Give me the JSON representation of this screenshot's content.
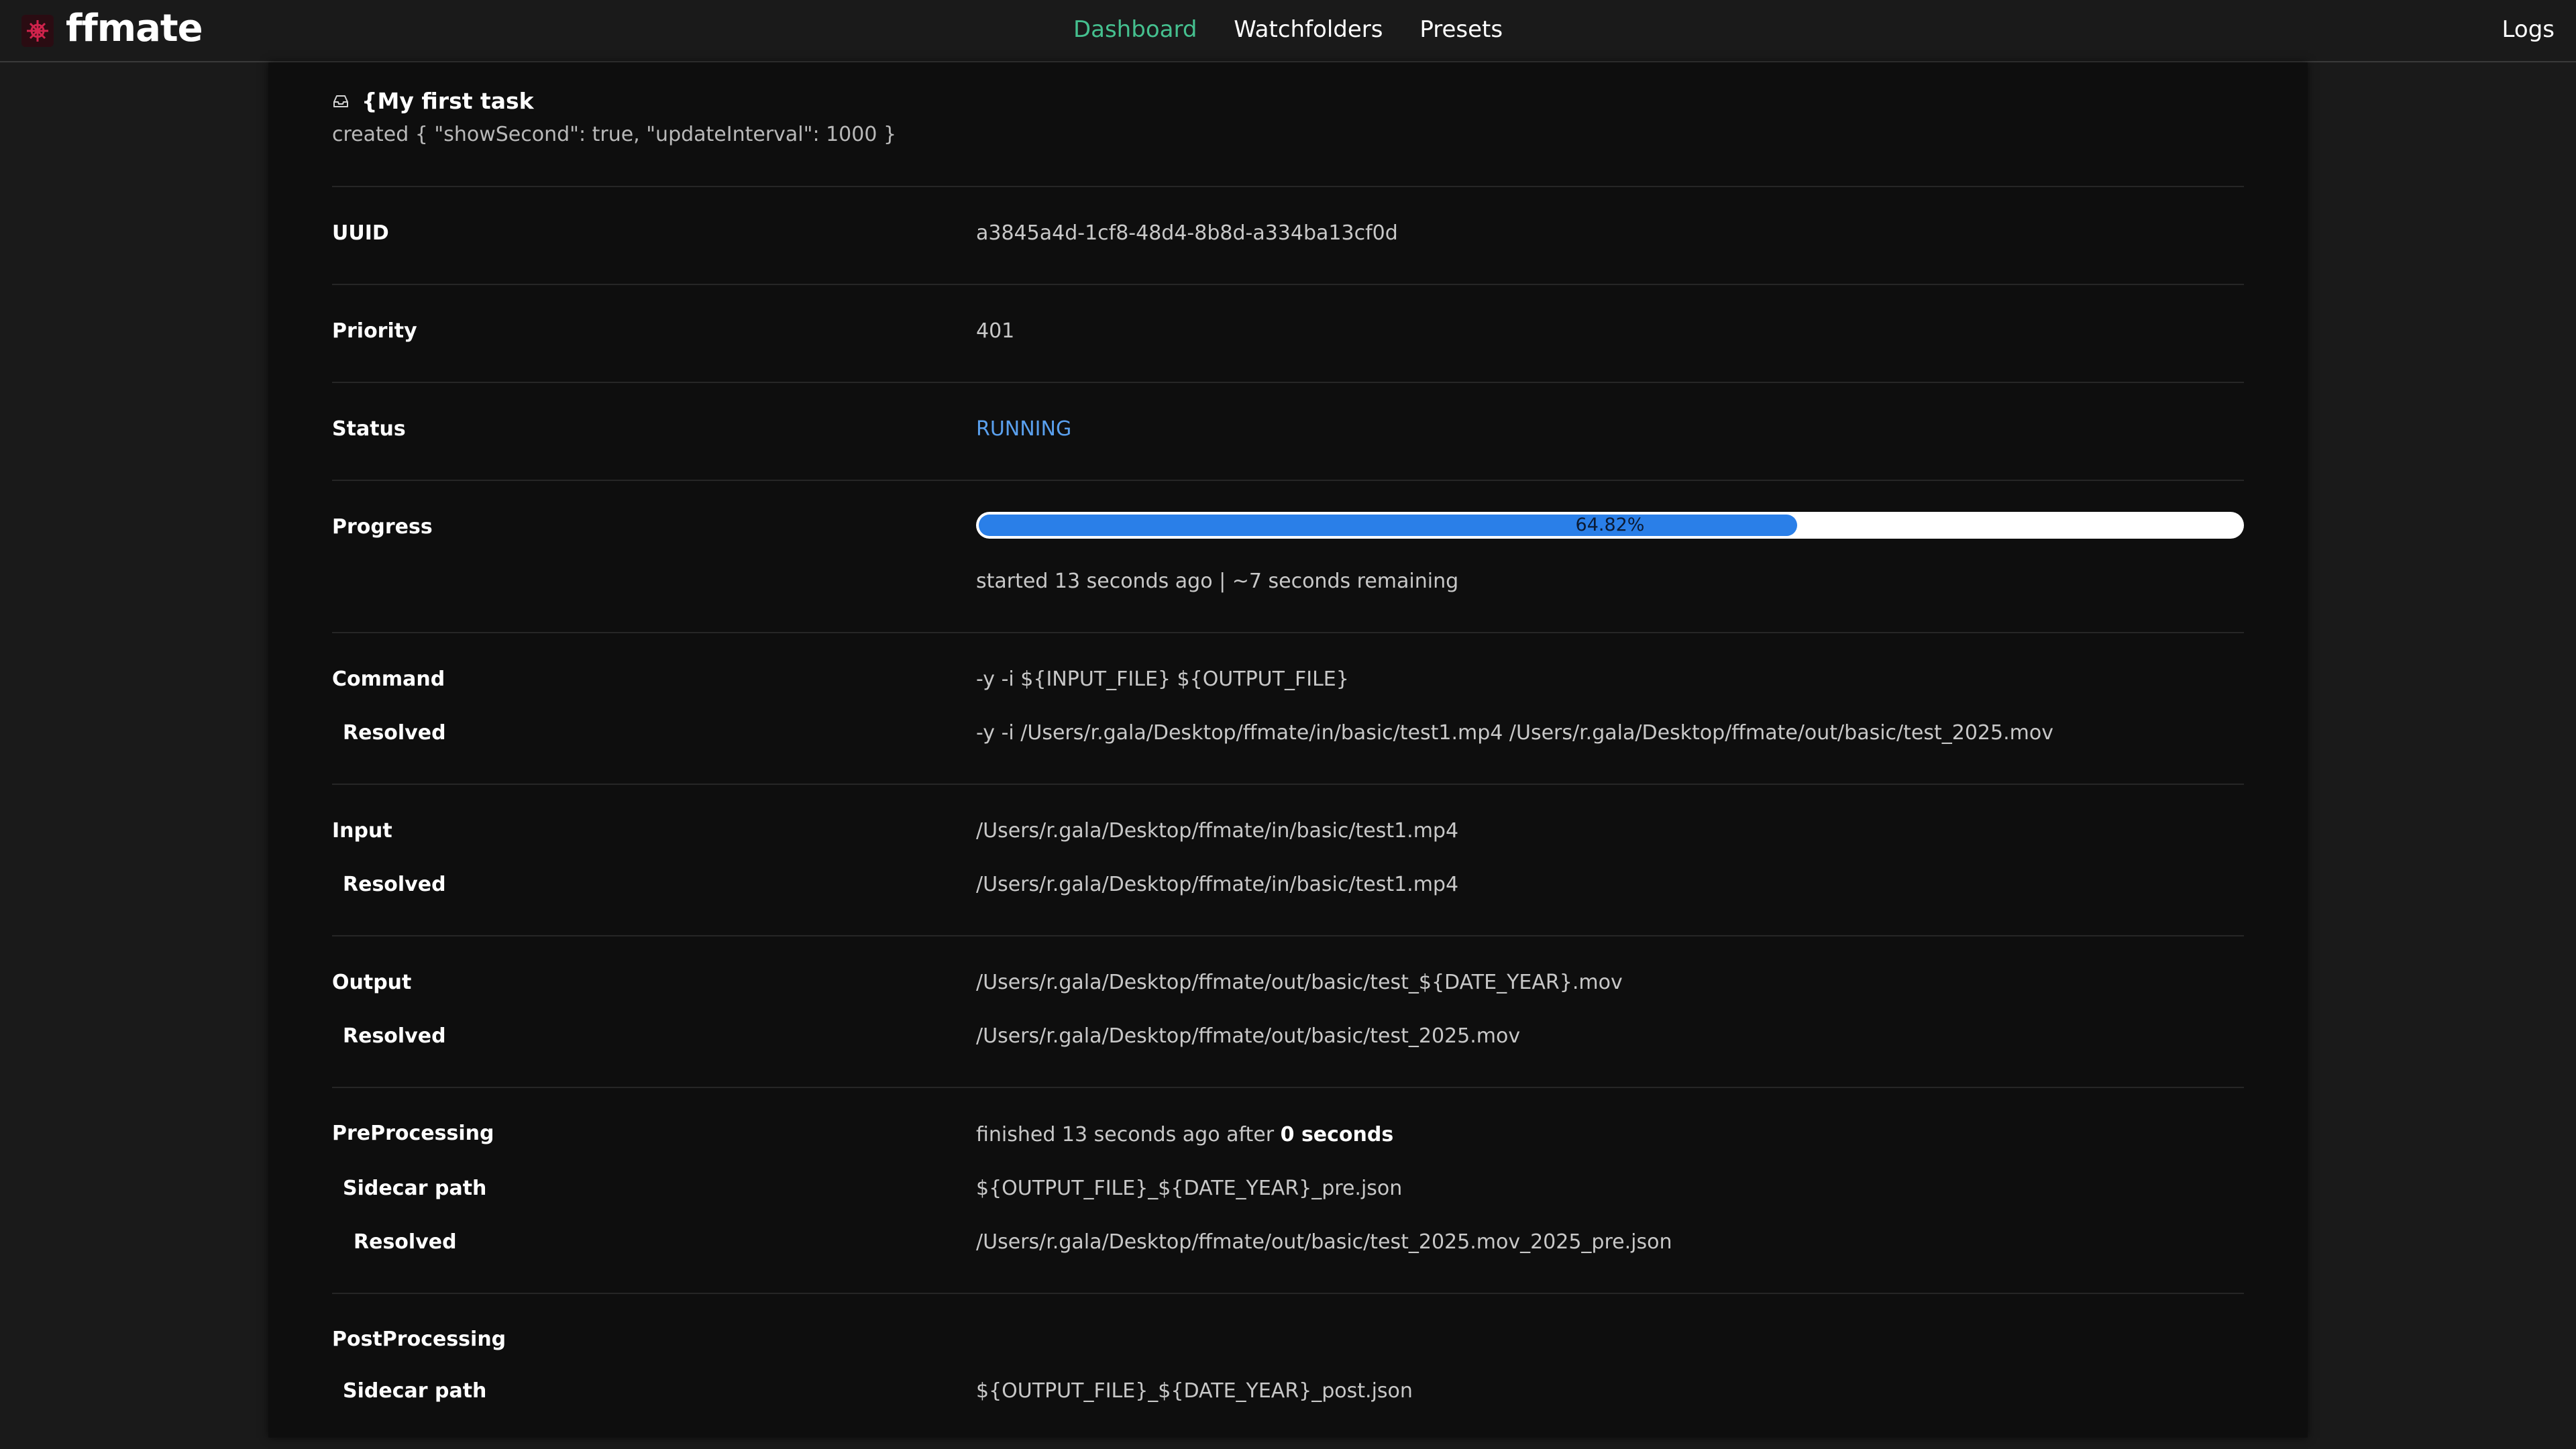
{
  "nav": {
    "brand": "ffmate",
    "links": [
      "Dashboard",
      "Watchfolders",
      "Presets"
    ],
    "active": "Dashboard",
    "logs": "Logs"
  },
  "task": {
    "title": "{My first task",
    "created": "created { \"showSecond\": true, \"updateInterval\": 1000 }",
    "uuid_label": "UUID",
    "uuid": "a3845a4d-1cf8-48d4-8b8d-a334ba13cf0d",
    "priority_label": "Priority",
    "priority": "401",
    "status_label": "Status",
    "status": "RUNNING",
    "progress_label": "Progress",
    "progress_percent": 64.82,
    "progress_text": "64.82%",
    "progress_meta": "started 13 seconds ago | ~7 seconds remaining",
    "command_label": "Command",
    "command": "-y -i ${INPUT_FILE} ${OUTPUT_FILE}",
    "resolved_label": "Resolved",
    "command_resolved": "-y -i /Users/r.gala/Desktop/ffmate/in/basic/test1.mp4 /Users/r.gala/Desktop/ffmate/out/basic/test_2025.mov",
    "input_label": "Input",
    "input": "/Users/r.gala/Desktop/ffmate/in/basic/test1.mp4",
    "input_resolved": "/Users/r.gala/Desktop/ffmate/in/basic/test1.mp4",
    "output_label": "Output",
    "output": "/Users/r.gala/Desktop/ffmate/out/basic/test_${DATE_YEAR}.mov",
    "output_resolved": "/Users/r.gala/Desktop/ffmate/out/basic/test_2025.mov",
    "pre_label": "PreProcessing",
    "pre_status_prefix": "finished 13 seconds ago after ",
    "pre_status_duration": "0 seconds",
    "sidecar_label": "Sidecar path",
    "pre_sidecar": "${OUTPUT_FILE}_${DATE_YEAR}_pre.json",
    "pre_sidecar_resolved": "/Users/r.gala/Desktop/ffmate/out/basic/test_2025.mov_2025_pre.json",
    "post_label": "PostProcessing",
    "post_sidecar": "${OUTPUT_FILE}_${DATE_YEAR}_post.json"
  },
  "colors": {
    "accent": "#45c08f",
    "status_running": "#5aa0ee",
    "progress_fill": "#2a7fe8"
  }
}
